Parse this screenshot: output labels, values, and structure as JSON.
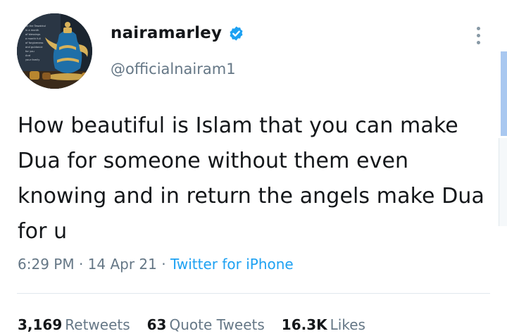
{
  "user": {
    "display_name": "nairamarley",
    "handle": "@officialnairam1",
    "verified": true,
    "avatar_text": [
      "Ask the Tawakkul",
      "in a month",
      "of blessings",
      "a month full",
      "of forgiveness",
      "and guidance",
      "for you",
      "And",
      "your family"
    ]
  },
  "tweet": {
    "text_lines": [
      "How beautiful is Islam that you can make",
      "Dua for someone without them even",
      "knowing and in return the angels make Dua",
      "for u"
    ],
    "time": "6:29 PM",
    "date": "14 Apr 21",
    "separator": "·",
    "source": "Twitter for iPhone"
  },
  "stats": {
    "retweets_count": "3,169",
    "retweets_label": "Retweets",
    "quotes_count": "63",
    "quotes_label": "Quote Tweets",
    "likes_count": "16.3K",
    "likes_label": "Likes"
  },
  "colors": {
    "link": "#1da1f2",
    "secondary": "#657786",
    "verified": "#1da1f2"
  },
  "icons": {
    "verified": "verified-badge-icon",
    "more": "more-vertical-icon"
  }
}
